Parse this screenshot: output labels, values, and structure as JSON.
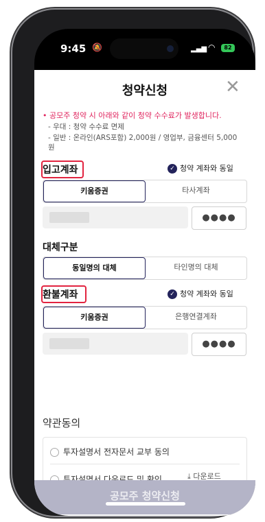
{
  "status": {
    "time": "9:45",
    "battery": "82"
  },
  "header": {
    "title": "청약신청",
    "close": "✕"
  },
  "notice": {
    "main": "공모주 청약 시 아래와 같이 청약 수수료가 발생합니다.",
    "line1": "- 우대 : 청약 수수료 면제",
    "line2": "- 일반 : 온라인(ARS포함) 2,000원 / 영업부, 금융센터 5,000원"
  },
  "deposit": {
    "label": "입고계좌",
    "agree": "청약 계좌와 동일",
    "options": [
      "키움증권",
      "타사계좌"
    ],
    "password_mask": "●●●●"
  },
  "substitute": {
    "label": "대체구분",
    "options": [
      "동일명의 대체",
      "타인명의 대체"
    ]
  },
  "refund": {
    "label": "환불계좌",
    "agree": "청약 계좌와 동일",
    "options": [
      "키움증권",
      "은행연결계좌"
    ],
    "password_mask": "●●●●"
  },
  "terms": {
    "title": "약관동의",
    "items": [
      "투자설명서 전자문서 교부 동의",
      "투자설명서 다운로드 및 확인"
    ],
    "download": "다운로드"
  },
  "cta": {
    "label": "공모주 청약신청"
  },
  "colors": {
    "accent": "#23235b",
    "highlight": "#e2233f",
    "notice": "#e0245e",
    "cta": "#b4b4c7"
  }
}
